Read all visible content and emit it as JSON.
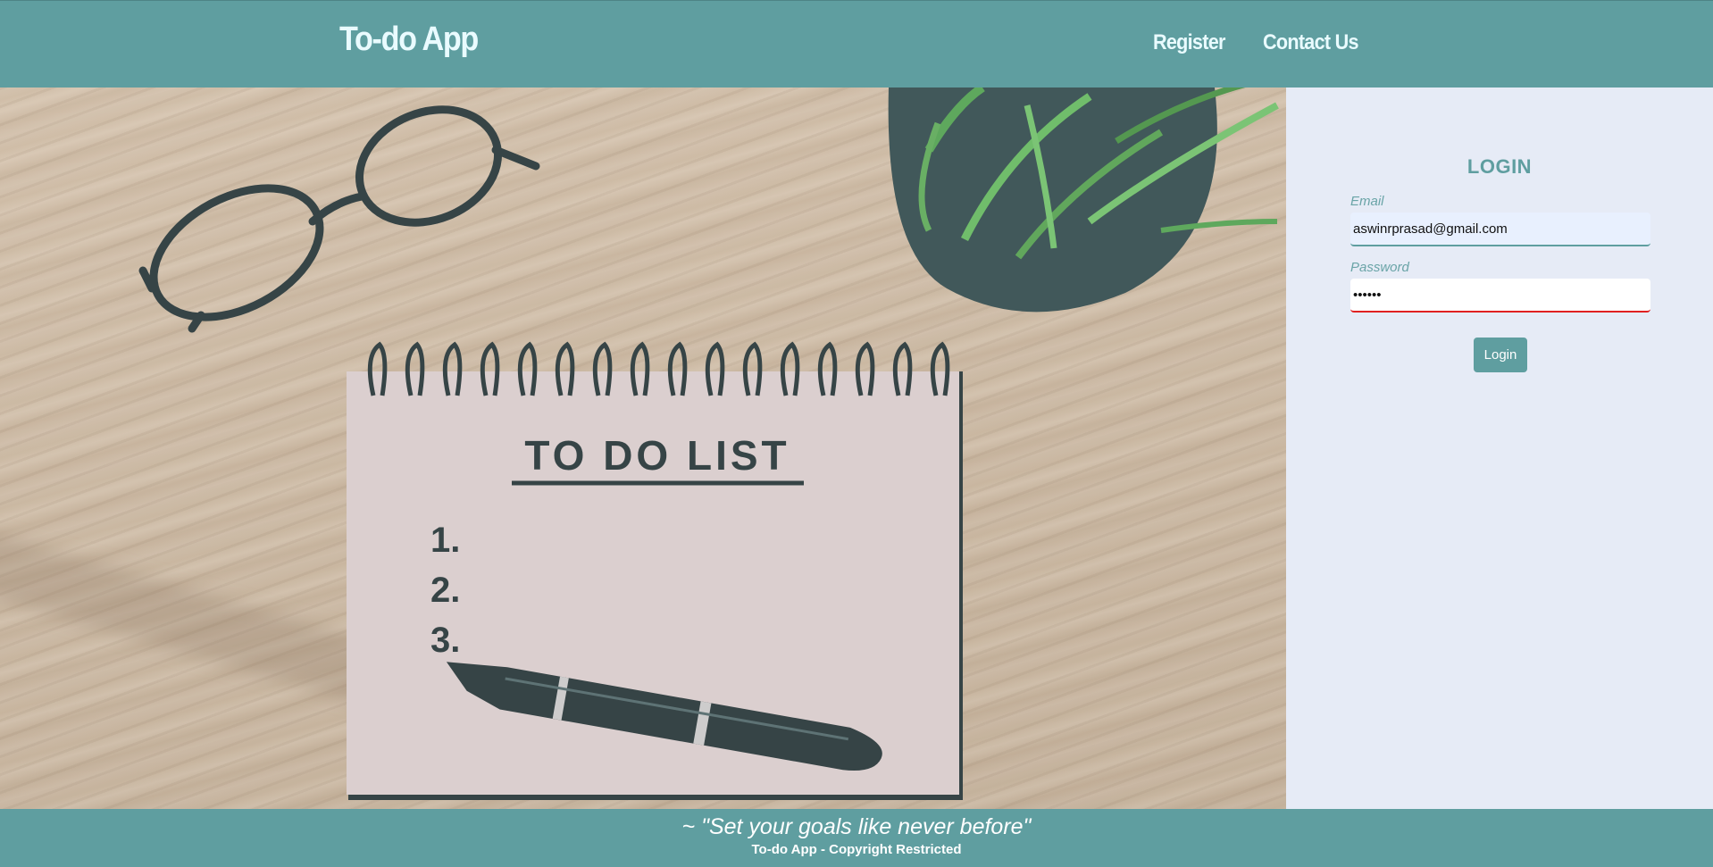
{
  "header": {
    "brand": "To-do App",
    "nav": {
      "register": "Register",
      "contact": "Contact Us"
    }
  },
  "hero": {
    "notebook_heading": "TO DO LIST",
    "list_numbers": [
      "1.",
      "2.",
      "3."
    ]
  },
  "login": {
    "title": "LOGIN",
    "email_label": "Email",
    "email_value": "aswinrprasad@gmail.com",
    "password_label": "Password",
    "password_value": "123456",
    "button": "Login"
  },
  "footer": {
    "quote": "~ \"Set your goals like never before\"",
    "copyright": "To-do App - Copyright Restricted"
  },
  "colors": {
    "primary": "#5f9ea0",
    "panel_bg": "#e6ebf6",
    "error": "#e02020"
  }
}
